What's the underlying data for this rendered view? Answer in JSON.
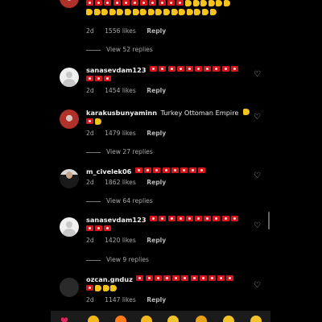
{
  "colors": {
    "background": "#000000",
    "flag_red": "#d4151b",
    "meta_gray": "#a8a8a8"
  },
  "top_comment": {
    "meta": {
      "time": "2d",
      "likes": "1556 likes",
      "reply": "Reply"
    },
    "view_replies": "View 52 replies"
  },
  "comments": [
    {
      "username": "sanasevdam123",
      "text": "",
      "meta": {
        "time": "2d",
        "likes": "1454 likes",
        "reply": "Reply"
      }
    },
    {
      "username": "karakusbunyaminn",
      "text": "Turkey Ottoman Empire",
      "meta": {
        "time": "2d",
        "likes": "1479 likes",
        "reply": "Reply"
      },
      "view_replies": "View 27 replies"
    },
    {
      "username": "m_civelek06",
      "text": "",
      "meta": {
        "time": "2d",
        "likes": "1862 likes",
        "reply": "Reply"
      },
      "view_replies": "View 64 replies"
    },
    {
      "username": "sanasevdam123",
      "text": "",
      "meta": {
        "time": "2d",
        "likes": "1420 likes",
        "reply": "Reply"
      },
      "view_replies": "View 9 replies"
    },
    {
      "username": "ozcan.gnduz",
      "text": "",
      "meta": {
        "time": "2d",
        "likes": "1147 likes",
        "reply": "Reply"
      }
    }
  ],
  "icons": {
    "like": "heart-outline-icon",
    "flag": "turkey-flag-emoji",
    "muscle": "flexed-biceps-emoji",
    "thumb": "thumbs-up-emoji",
    "punch": "oncoming-fist-emoji"
  },
  "emoji_bar": [
    "red-heart-emoji",
    "raising-hands-emoji",
    "fire-emoji",
    "clapping-emoji",
    "crying-face-emoji",
    "heart-eyes-emoji",
    "surprised-face-emoji",
    "laughing-face-emoji"
  ]
}
